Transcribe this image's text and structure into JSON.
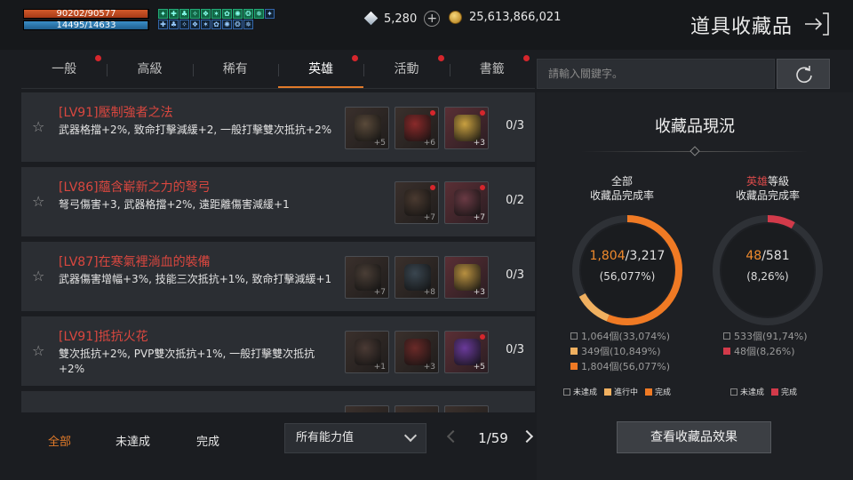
{
  "hud": {
    "hp_text": "90202/90577",
    "hp_fraction": 0.996,
    "mp_text": "14495/14633",
    "mp_fraction": 0.99,
    "buff_count": 20
  },
  "currency": {
    "diamond": "5,280",
    "gold": "25,613,866,021"
  },
  "window": {
    "title": "道具收藏品"
  },
  "tabs": [
    {
      "label": "一般",
      "dot": true,
      "active": false
    },
    {
      "label": "高級",
      "dot": false,
      "active": false
    },
    {
      "label": "稀有",
      "dot": false,
      "active": false
    },
    {
      "label": "英雄",
      "dot": true,
      "active": true
    },
    {
      "label": "活動",
      "dot": true,
      "active": false
    },
    {
      "label": "書籤",
      "dot": true,
      "active": false
    }
  ],
  "collections": [
    {
      "title": "[LV91]壓制強者之法",
      "desc": "武器格擋+2%, 致命打擊減緩+2, 一般打擊雙次抵抗+2%",
      "progress": "0/3",
      "items": [
        {
          "lvl": "+5",
          "color": "#5a4a3a",
          "owned": false,
          "dot": false
        },
        {
          "lvl": "+6",
          "color": "#8a2a2a",
          "owned": false,
          "dot": true
        },
        {
          "lvl": "+3",
          "color": "#c9a040",
          "owned": true,
          "dot": true
        }
      ]
    },
    {
      "title": "[LV86]蘊含嶄新之力的弩弓",
      "desc": "弩弓傷害+3, 武器格擋+2%, 遠距離傷害減緩+1",
      "progress": "0/2",
      "items": [
        {
          "lvl": "+7",
          "color": "#4a3a30",
          "owned": false,
          "dot": true
        },
        {
          "lvl": "+7",
          "color": "#6a3a44",
          "owned": true,
          "dot": true
        }
      ]
    },
    {
      "title": "[LV87]在寒氣裡淌血的裝備",
      "desc": "武器傷害增幅+3%, 技能三次抵抗+1%, 致命打擊減緩+1",
      "progress": "0/3",
      "items": [
        {
          "lvl": "+7",
          "color": "#4a3e36",
          "owned": false,
          "dot": false
        },
        {
          "lvl": "+8",
          "color": "#3a4650",
          "owned": false,
          "dot": false
        },
        {
          "lvl": "+3",
          "color": "#b89040",
          "owned": true,
          "dot": false
        }
      ]
    },
    {
      "title": "[LV91]抵抗火花",
      "desc": "雙次抵抗+2%, PVP雙次抵抗+1%, 一般打擊雙次抵抗+2%",
      "progress": "0/3",
      "items": [
        {
          "lvl": "+1",
          "color": "#4a3a34",
          "owned": false,
          "dot": false
        },
        {
          "lvl": "+3",
          "color": "#6a2a28",
          "owned": false,
          "dot": false
        },
        {
          "lvl": "+5",
          "color": "#6a3a9a",
          "owned": true,
          "dot": true
        }
      ]
    },
    {
      "title": "",
      "desc": "",
      "progress": "",
      "items": [
        {
          "lvl": "",
          "color": "#4a3a34",
          "owned": false,
          "dot": false
        },
        {
          "lvl": "",
          "color": "#4a3a34",
          "owned": false,
          "dot": false
        },
        {
          "lvl": "",
          "color": "#b89040",
          "owned": false,
          "dot": false
        }
      ]
    }
  ],
  "bottom": {
    "filters": [
      "全部",
      "未達成",
      "完成"
    ],
    "active_filter": 0,
    "dropdown": "所有能力值",
    "page": "1/59"
  },
  "search": {
    "placeholder": "請輸入關鍵字。"
  },
  "panel": {
    "title": "收藏品現況",
    "left": {
      "label_line1": "全部",
      "label_line2": "收藏品完成率",
      "done": "1,804",
      "total": "/3,217",
      "pct": "(56,077%)",
      "done_fraction": 0.56077,
      "inprogress_fraction": 0.10849,
      "stats": [
        {
          "text": "1,064個(33,074%)",
          "color": "#1e2024"
        },
        {
          "text": "349個(10,849%)",
          "color": "#f0b060"
        },
        {
          "text": "1,804個(56,077%)",
          "color": "#f07a24"
        }
      ],
      "legend": [
        {
          "label": "未達成",
          "color": "#1e2024"
        },
        {
          "label": "進行中",
          "color": "#f0b060"
        },
        {
          "label": "完成",
          "color": "#f07a24"
        }
      ]
    },
    "right": {
      "label_accent": "英雄",
      "label_line1_rest": "等級",
      "label_line2": "收藏品完成率",
      "done": "48",
      "total": "/581",
      "pct": "(8,26%)",
      "done_fraction": 0.0826,
      "stats": [
        {
          "text": "533個(91,74%)",
          "color": "#1e2024"
        },
        {
          "text": "48個(8,26%)",
          "color": "#d23a4a"
        }
      ],
      "legend": [
        {
          "label": "未達成",
          "color": "#1e2024"
        },
        {
          "label": "完成",
          "color": "#d23a4a"
        }
      ]
    },
    "effect_button": "查看收藏品效果"
  }
}
